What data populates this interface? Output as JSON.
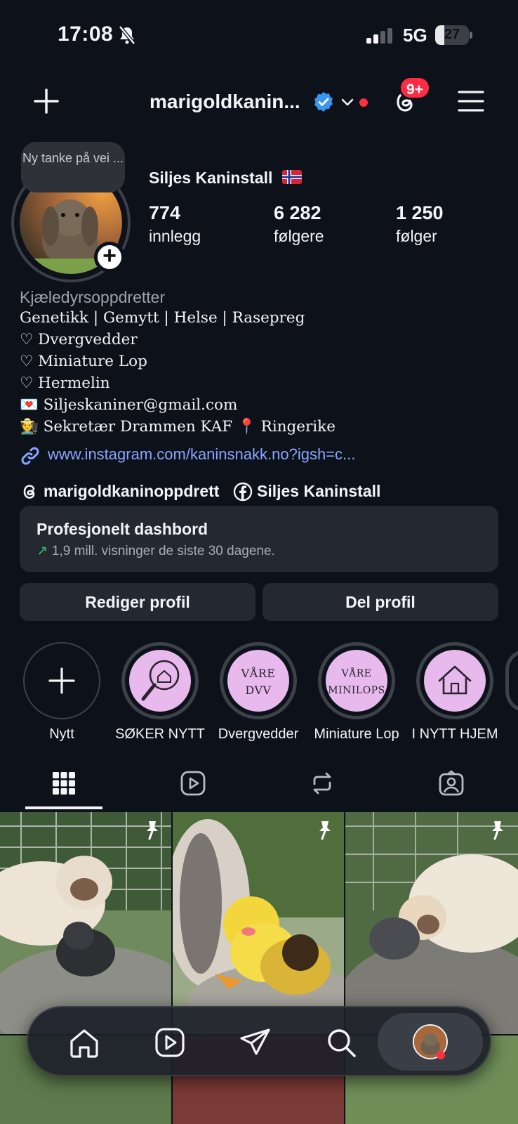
{
  "status_bar": {
    "time": "17:08",
    "network": "5G",
    "battery_level": "27",
    "battery_fraction": 0.27
  },
  "header": {
    "username": "marigoldkanin...",
    "notification_badge": "9+",
    "verified": true
  },
  "profile": {
    "note": "Ny tanke på vei ...",
    "display_name": "Siljes Kaninstall",
    "flag": "norway-flag",
    "stats": [
      {
        "value": "774",
        "label": "innlegg"
      },
      {
        "value": "6 282",
        "label": "følgere"
      },
      {
        "value": "1 250",
        "label": "følger"
      }
    ],
    "category": "Kjæledyrsoppdretter",
    "bio_lines": [
      "Genetikk | Gemytt | Helse | Rasepreg",
      "♡ Dvergvedder",
      "♡ Miniature Lop",
      "♡ Hermelin",
      "💌 Siljeskaniner@gmail.com",
      "🧑‍🌾 Sekretær Drammen KAF 📍 Ringerike"
    ],
    "link": "www.instagram.com/kaninsnakk.no?igsh=c...",
    "threads_handle": "marigoldkaninoppdrett",
    "facebook_name": "Siljes Kaninstall"
  },
  "dashboard": {
    "title": "Profesjonelt dashbord",
    "subtitle": "1,9 mill. visninger de siste 30 dagene."
  },
  "buttons": {
    "edit_profile": "Rediger profil",
    "share_profile": "Del profil"
  },
  "highlights": [
    {
      "label": "Nytt",
      "icon": "plus-icon"
    },
    {
      "label": "SØKER NYTT",
      "icon": "magnifier-house-icon"
    },
    {
      "label": "Dvergvedder",
      "text": "VÅRE DVV"
    },
    {
      "label": "Miniature Lop",
      "text": "VÅRE MINILOPS"
    },
    {
      "label": "I NYTT HJEM",
      "icon": "house-icon"
    }
  ],
  "tabs": [
    "grid-icon",
    "reels-icon",
    "reposts-icon",
    "tagged-icon"
  ],
  "bottom_nav": [
    "home-icon",
    "reels-icon",
    "messages-icon",
    "search-icon",
    "profile-avatar"
  ],
  "colors": {
    "background": "#0c111a",
    "card": "#232831",
    "link": "#8aa5ff",
    "badge": "#ff2b44",
    "verified": "#3897f0",
    "highlight_fill": "#e7b9ec"
  }
}
